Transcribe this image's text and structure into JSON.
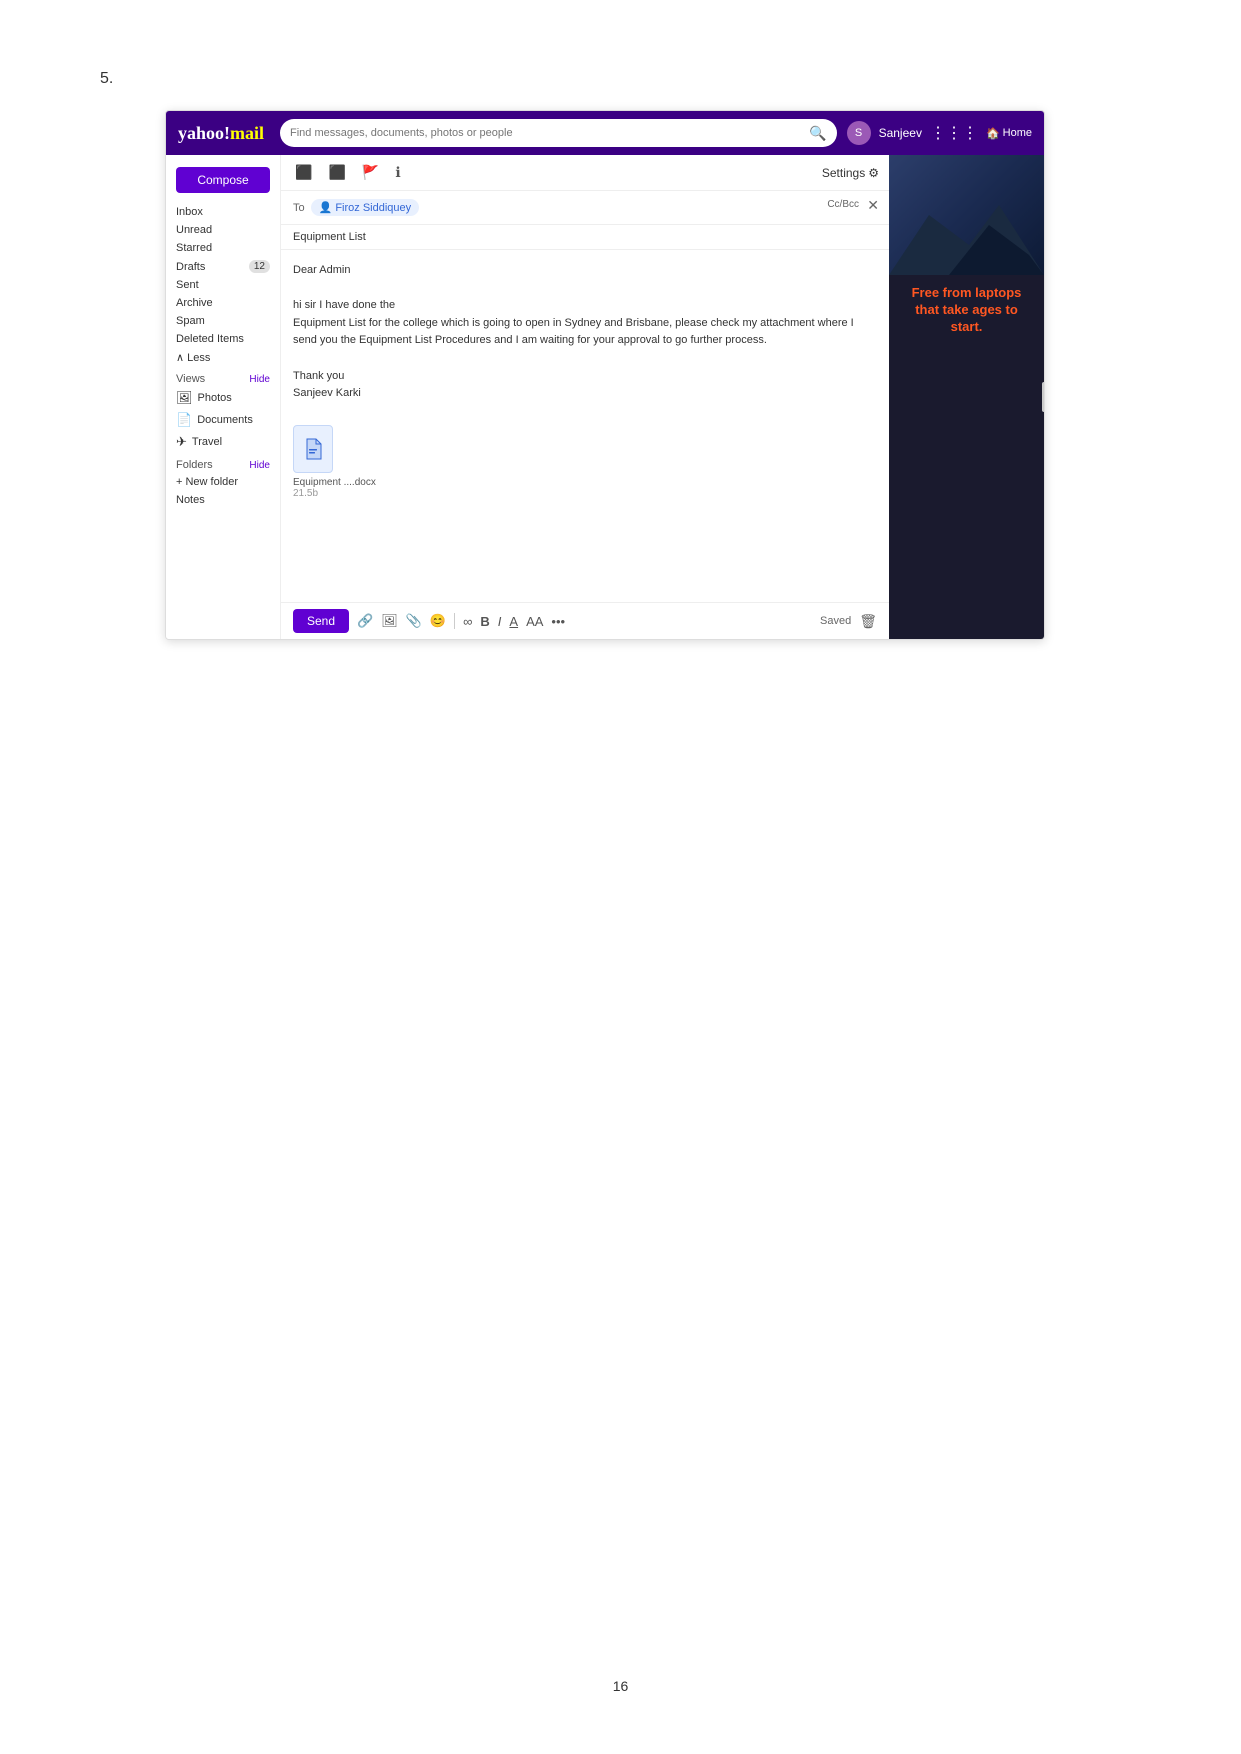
{
  "page": {
    "step_label": "5.",
    "page_number": "16"
  },
  "header": {
    "logo_text": "yahoo!mail",
    "search_placeholder": "Find messages, documents, photos or people",
    "user_name": "Sanjeev",
    "home_label": "Home",
    "avatar_initial": "S"
  },
  "sidebar": {
    "compose_label": "Compose",
    "items": [
      {
        "label": "Inbox",
        "badge": ""
      },
      {
        "label": "Unread",
        "badge": ""
      },
      {
        "label": "Starred",
        "badge": ""
      },
      {
        "label": "Drafts",
        "badge": "12"
      },
      {
        "label": "Sent",
        "badge": ""
      },
      {
        "label": "Archive",
        "badge": ""
      },
      {
        "label": "Spam",
        "badge": ""
      },
      {
        "label": "Deleted Items",
        "badge": ""
      },
      {
        "label": "∧ Less",
        "badge": ""
      }
    ],
    "views_label": "Views",
    "views_hide": "Hide",
    "view_items": [
      {
        "icon": "photo",
        "label": "Photos"
      },
      {
        "icon": "doc",
        "label": "Documents"
      },
      {
        "icon": "travel",
        "label": "Travel"
      }
    ],
    "folders_label": "Folders",
    "folders_hide": "Hide",
    "folder_items": [
      {
        "label": "+ New folder"
      },
      {
        "label": "Notes"
      }
    ]
  },
  "toolbar": {
    "icons": [
      "⬛",
      "⬛",
      "🚩",
      "ℹ"
    ],
    "settings_label": "Settings"
  },
  "compose": {
    "to_label": "To",
    "recipient": "Firoz Siddiquey",
    "cc_label": "Cc/Bcc",
    "subject": "Equipment List",
    "body_greeting": "Dear Admin",
    "body_intro": "hi sir I have done the",
    "body_main": "Equipment List for the college which is going to open in Sydney and Brisbane, please check my attachment where I send you the Equipment List Procedures and I am waiting for your approval to go further process.",
    "body_closing": "Thank you\nSanjeev Karki",
    "attachment_name": "Equipment ....docx",
    "attachment_size": "21.5b"
  },
  "bottom_toolbar": {
    "send_label": "Send",
    "saved_label": "Saved",
    "format_icons": [
      "🔗",
      "⬛",
      "⬛",
      "⊕",
      "∞",
      "B",
      "I",
      "A",
      "AA",
      "•••"
    ]
  },
  "ad": {
    "headline": "Free from laptops that take ages to start.",
    "expand_icon": "›"
  }
}
